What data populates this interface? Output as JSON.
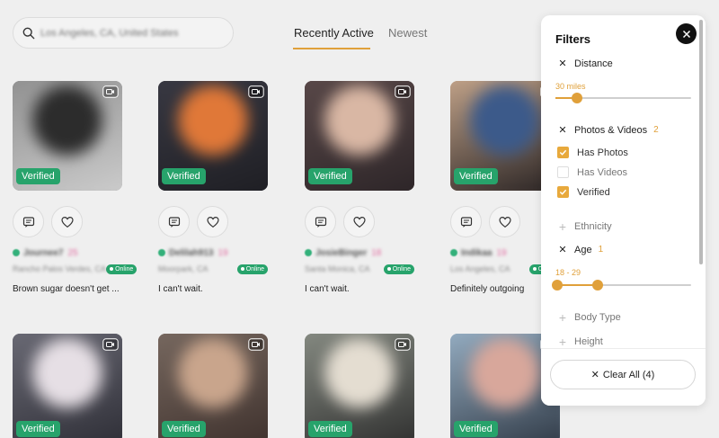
{
  "search": {
    "placeholder": "Los Angeles, CA, United States",
    "icon": "search-icon"
  },
  "tabs": [
    {
      "label": "Recently Active",
      "active": true
    },
    {
      "label": "Newest",
      "active": false
    }
  ],
  "accent_color": "#e0a03a",
  "verified_color": "#27a36b",
  "cards": [
    {
      "verified": "Verified",
      "name": "Journee7",
      "age": "25",
      "location": "Rancho Palos Verdes, CA",
      "online": "Online",
      "bio": "Brown sugar doesn't get ...",
      "photo_colors": [
        "#8d8d8d",
        "#2c2c2c",
        "#cfcfcf"
      ]
    },
    {
      "verified": "Verified",
      "name": "Delilah913",
      "age": "19",
      "location": "Moorpark, CA",
      "online": "Online",
      "bio": "I can't wait.",
      "photo_colors": [
        "#3a3a44",
        "#e07838",
        "#1d1d22"
      ]
    },
    {
      "verified": "Verified",
      "name": "JosieBinger",
      "age": "18",
      "location": "Santa Monica, CA",
      "online": "Online",
      "bio": "I can't wait.",
      "photo_colors": [
        "#5b4a4a",
        "#d9b7a4",
        "#2a2326"
      ]
    },
    {
      "verified": "Verified",
      "name": "Indikaa",
      "age": "19",
      "location": "Los Angeles, CA",
      "online": "Online",
      "bio": "Definitely outgoing",
      "photo_colors": [
        "#c9a98e",
        "#3c5a8a",
        "#1e1a1c"
      ]
    },
    {
      "verified": "Verified",
      "photo_colors": [
        "#6d6d78",
        "#e6dfe5",
        "#2b2b33"
      ]
    },
    {
      "verified": "Verified",
      "photo_colors": [
        "#7a6b62",
        "#c9a58c",
        "#3b2e2a"
      ]
    },
    {
      "verified": "Verified",
      "photo_colors": [
        "#8a8f86",
        "#e4ddd1",
        "#2a2a2a"
      ]
    },
    {
      "verified": "Verified",
      "photo_colors": [
        "#9ab3c8",
        "#d8a79b",
        "#2b3440"
      ]
    }
  ],
  "cards_bio_second": "I can't wait.",
  "filters": {
    "title": "Filters",
    "close_icon": "close-icon",
    "sections": {
      "distance": {
        "label": "Distance",
        "value": "30 miles",
        "fraction": 0.16
      },
      "photos": {
        "label": "Photos & Videos",
        "count": "2",
        "options": [
          {
            "label": "Has Photos",
            "checked": true
          },
          {
            "label": "Has Videos",
            "checked": false
          },
          {
            "label": "Verified",
            "checked": true
          }
        ]
      },
      "ethnicity": {
        "label": "Ethnicity"
      },
      "age": {
        "label": "Age",
        "count": "1",
        "value": "18 - 29",
        "low_fraction": 0.0,
        "high_fraction": 0.31
      },
      "body_type": {
        "label": "Body Type"
      },
      "height": {
        "label": "Height"
      }
    },
    "clear_all": "Clear All (4)"
  }
}
